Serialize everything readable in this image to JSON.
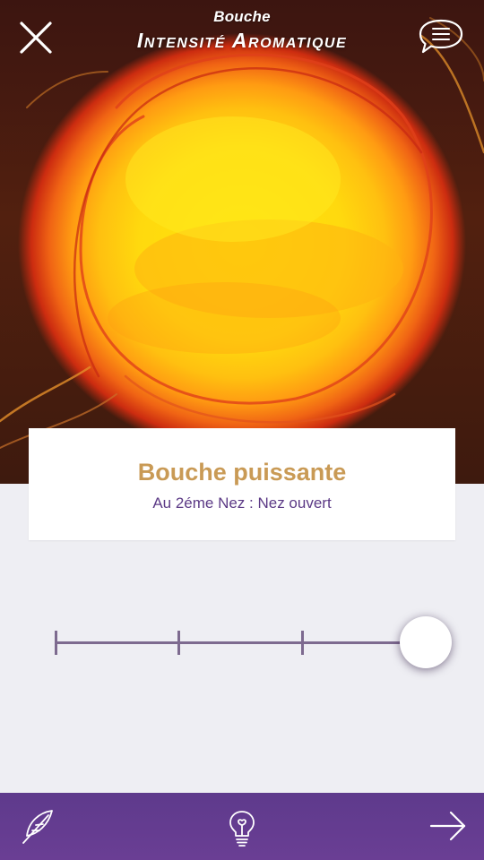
{
  "header": {
    "section": "Bouche",
    "title": "Intensité Aromatique",
    "icons": {
      "close": "close-icon",
      "menu": "menu-bubble-icon"
    }
  },
  "result": {
    "title": "Bouche puissante",
    "subtitle": "Au 2éme Nez : Nez ouvert"
  },
  "slider": {
    "steps": 4,
    "selected_index": 3
  },
  "bottom_bar": {
    "icons": [
      "feather-icon",
      "lightbulb-icon",
      "arrow-right-icon"
    ]
  },
  "colors": {
    "accent_purple": "#62408f",
    "title_gold": "#c99a55",
    "subtitle_purple": "#5c3a86",
    "track": "#7d6a8f"
  }
}
